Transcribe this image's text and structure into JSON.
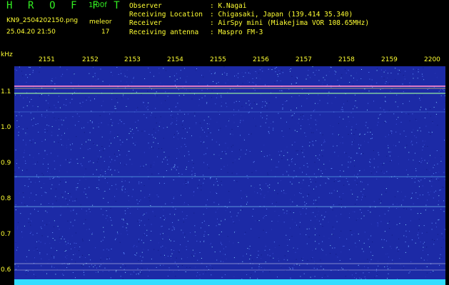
{
  "header": {
    "app_title": "H R O F F T",
    "version": "1.00f",
    "filename": "KN9_2504202150.png",
    "timestamp": "25.04.20 21:50",
    "meteor_label": "meleor",
    "meteor_count": "17",
    "info": [
      {
        "key": "Observer",
        "value": ": K.Nagai"
      },
      {
        "key": "Receiving Location",
        "value": ": Chigasaki, Japan (139.414 35.340)"
      },
      {
        "key": "Receiver",
        "value": ": AirSpy mini (Miakejima VOR 108.65MHz)"
      },
      {
        "key": "Receiving antenna",
        "value": ": Maspro FM-3"
      }
    ]
  },
  "axes": {
    "y_unit": "kHz",
    "x_ticks": [
      "2151",
      "2152",
      "2153",
      "2154",
      "2155",
      "2156",
      "2157",
      "2158",
      "2159",
      "2200"
    ],
    "y_ticks": [
      "1.1",
      "1.0",
      "0.9",
      "0.8",
      "0.7",
      "0.6"
    ]
  },
  "colors": {
    "background": "#1c2aa6",
    "text": "#ffff33",
    "title": "#33ee22",
    "bottom_band": "#33ddff"
  }
}
